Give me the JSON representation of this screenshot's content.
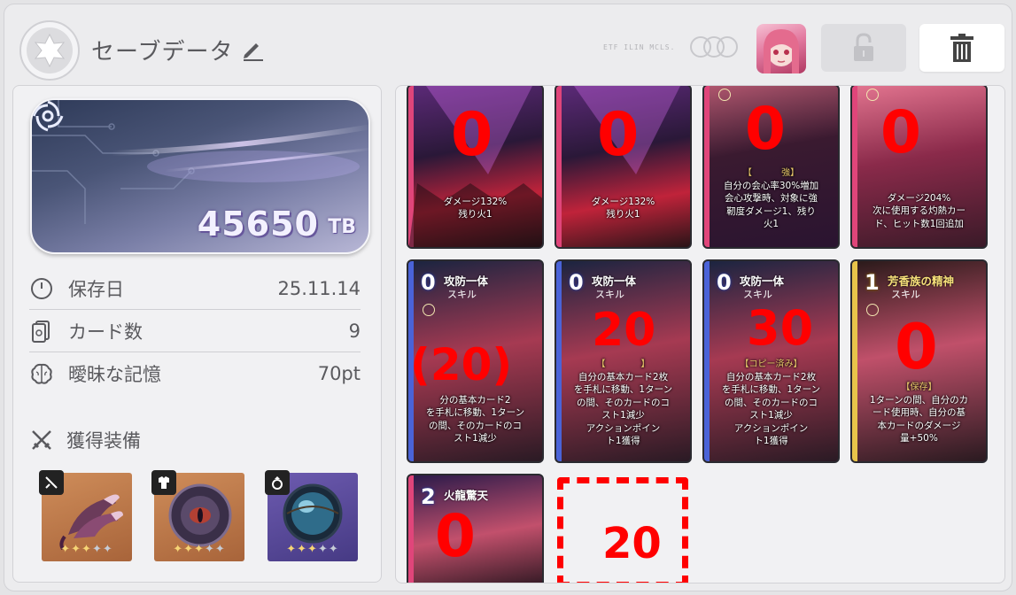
{
  "header": {
    "title": "セーブデータ",
    "faint_text": "ETF ILIN MCLS."
  },
  "summary": {
    "value": "45650",
    "unit": "TB"
  },
  "stats": [
    {
      "label": "保存日",
      "value": "25.11.14",
      "icon": "clock-icon"
    },
    {
      "label": "カード数",
      "value": "9",
      "icon": "card-icon"
    },
    {
      "label": "曖昧な記憶",
      "value": "70pt",
      "icon": "brain-icon"
    }
  ],
  "equipment": {
    "label": "獲得装備",
    "items": [
      {
        "slot": "weapon",
        "stars": 3,
        "max_stars": 5,
        "color": "#b9774a"
      },
      {
        "slot": "armor",
        "stars": 3,
        "max_stars": 5,
        "color": "#b9774a"
      },
      {
        "slot": "ring",
        "stars": 3,
        "max_stars": 5,
        "color": "#5a4a9a"
      }
    ]
  },
  "cards": [
    {
      "id": "c1",
      "desc": [
        "ダメージ132%",
        "残り火1"
      ],
      "mark": "0"
    },
    {
      "id": "c2",
      "desc": [
        "ダメージ132%",
        "残り火1"
      ],
      "mark": "0"
    },
    {
      "id": "c3",
      "desc_lead": "【　　　 強】",
      "desc": [
        "自分の会心率30%増加",
        "会心攻撃時、対象に強",
        "靭度ダメージ1、残り",
        "火1"
      ],
      "mark": "0"
    },
    {
      "id": "c4",
      "desc": [
        "ダメージ204%",
        "次に使用する灼熱カー",
        "ド、ヒット数1回追加"
      ],
      "mark": "0"
    },
    {
      "id": "c5",
      "cost": "0",
      "name": "攻防一体",
      "type": "スキル",
      "desc": [
        "分の基本カード2",
        "を手札に移動、1ターン",
        "の間、そのカードのコ",
        "スト1減少"
      ],
      "mark": "(20)"
    },
    {
      "id": "c6",
      "cost": "0",
      "name": "攻防一体",
      "type": "スキル",
      "desc_lead": "【　　　　】",
      "desc": [
        "自分の基本カード2枚",
        "を手札に移動、1ターン",
        "の間、そのカードのコ",
        "スト1減少",
        "アクションポイン",
        "ト1獲得"
      ],
      "mark": "20"
    },
    {
      "id": "c7",
      "cost": "0",
      "name": "攻防一体",
      "type": "スキル",
      "desc_lead": "【コピー済み】",
      "desc": [
        "自分の基本カード2枚",
        "を手札に移動、1ターン",
        "の間、そのカードのコ",
        "スト1減少",
        "アクションポイン",
        "ト1獲得"
      ],
      "mark": "30"
    },
    {
      "id": "c8",
      "cost": "1",
      "name": "芳香族の精神",
      "type": "スキル",
      "desc_lead": "【保存】",
      "desc": [
        "1ターンの間、自分のカ",
        "ード使用時、自分の基",
        "本カードのダメージ",
        "量+50%"
      ],
      "mark": "0"
    },
    {
      "id": "c9",
      "cost": "2",
      "name": "火龍驚天",
      "type": "",
      "mark": "0"
    }
  ],
  "empty_slot": {
    "mark": "20"
  },
  "colors": {
    "mark": "#ff0000",
    "accent_purple": "#6a5aa0",
    "card_edge_blue": "#4a63d8",
    "card_edge_pink": "#e0457a"
  }
}
